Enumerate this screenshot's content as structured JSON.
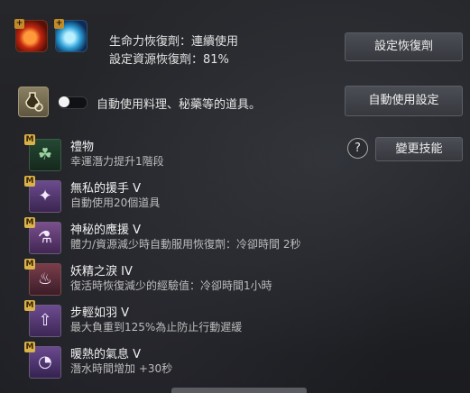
{
  "top": {
    "line1": "生命力恢復劑：連續使用",
    "line2": "設定資源恢復劑：81%",
    "set_button": "設定恢復劑"
  },
  "auto": {
    "toggle_label": "自動使用料理、秘藥等的道具。",
    "toggle_on": false,
    "button": "自動使用設定"
  },
  "skills_header": {
    "help": "?",
    "change_button": "變更技能"
  },
  "skills": [
    {
      "badge": "M",
      "name": "禮物",
      "desc": "幸運潛力提升1階段"
    },
    {
      "badge": "M",
      "name": "無私的援手 V",
      "desc": "自動使用20個道具"
    },
    {
      "badge": "M",
      "name": "神秘的應援 V",
      "desc": "體力/資源減少時自動服用恢復劑：冷卻時間 2秒"
    },
    {
      "badge": "M",
      "name": "妖精之淚 IV",
      "desc": "復活時恢復減少的經驗值：冷卻時間1小時"
    },
    {
      "badge": "M",
      "name": "步輕如羽 V",
      "desc": "最大負重到125%為止防止行動遲緩"
    },
    {
      "badge": "M",
      "name": "暖熱的氣息 V",
      "desc": "潛水時間增加 +30秒"
    }
  ],
  "icons": {
    "potion_red": "red-potion-icon",
    "potion_blue": "blue-potion-icon",
    "settings": "potion-gear-icon"
  }
}
